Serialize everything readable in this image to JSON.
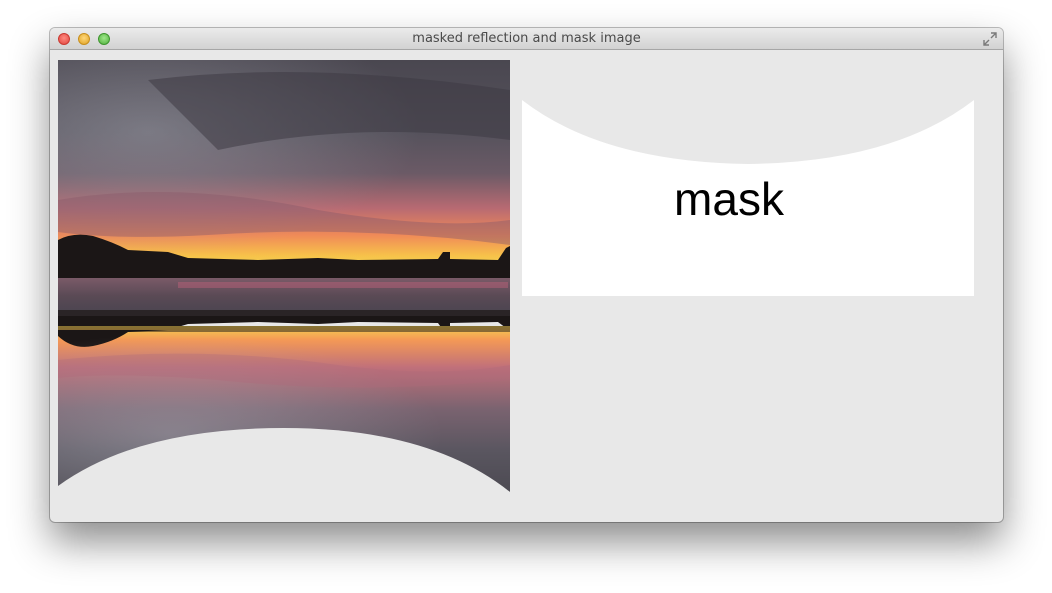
{
  "window": {
    "title": "masked reflection and mask image",
    "controls": [
      "close-button",
      "minimize-button",
      "zoom-button"
    ],
    "fullscreen_icon": "fullscreen-arrows-icon"
  },
  "masked_reflection": {
    "image": "sunset-lake-reflection",
    "description_icon": "photo"
  },
  "mask_image": {
    "label": "mask"
  },
  "colors": {
    "window_bg": "#e8e8e8",
    "mask_fill": "#ffffff",
    "mask_text": "#000000"
  }
}
